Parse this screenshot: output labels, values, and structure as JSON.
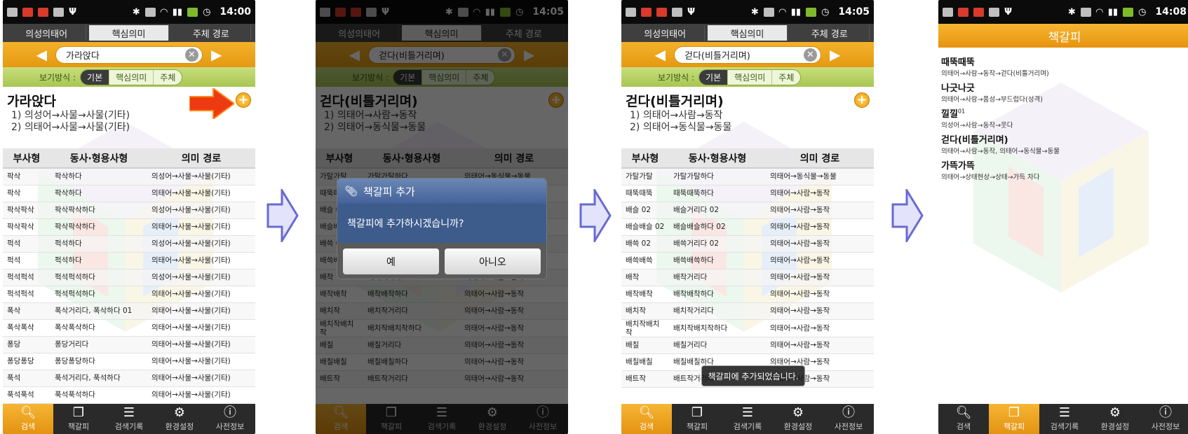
{
  "status": [
    {
      "time": "14:00"
    },
    {
      "time": "14:05"
    },
    {
      "time": "14:05"
    },
    {
      "time": "14:08"
    }
  ],
  "tabs": [
    "의성의태어",
    "핵심의미",
    "주체 경로"
  ],
  "search": [
    {
      "value": "가라앉다"
    },
    {
      "value": "걷다(비틀거리며)"
    },
    {
      "value": "걷다(비틀거리며)"
    }
  ],
  "view": {
    "label": "보기방식 :",
    "options": [
      "기본",
      "핵심의미",
      "주체"
    ]
  },
  "headers": [
    "부사형",
    "동사·형용사형",
    "의미 경로"
  ],
  "screen1": {
    "word": "가라앉다",
    "senses": [
      "1) 의성어→사물→사물(기타)",
      "2) 의태어→사물→사물(기타)"
    ],
    "rows": [
      [
        "팍삭",
        "팍삭하다",
        "의성어→사물→사물(기타)"
      ],
      [
        "팍삭",
        "팍삭하다",
        "의태어→사물→사물(기타)"
      ],
      [
        "팍삭팍삭",
        "팍삭팍삭하다",
        "의성어→사물→사물(기타)"
      ],
      [
        "팍삭팍삭",
        "팍삭팍삭하다",
        "의태어→사물→사물(기타)"
      ],
      [
        "퍽석",
        "퍽석하다",
        "의성어→사물→사물(기타)"
      ],
      [
        "퍽석",
        "퍽석하다",
        "의태어→사물→사물(기타)"
      ],
      [
        "퍽석퍽석",
        "퍽석퍽석하다",
        "의성어→사물→사물(기타)"
      ],
      [
        "퍽석퍽석",
        "퍽석퍽석하다",
        "의태어→사물→사물(기타)"
      ],
      [
        "폭삭",
        "폭삭거리다, 폭삭하다 01",
        "의태어→사물→사물(기타)"
      ],
      [
        "폭삭폭삭",
        "폭삭폭삭하다",
        "의태어→사물→사물(기타)"
      ],
      [
        "퐁당",
        "퐁당거리다",
        "의태어→사물→사물(기타)"
      ],
      [
        "퐁당퐁당",
        "퐁당퐁당하다",
        "의태어→사물→사물(기타)"
      ],
      [
        "푹석",
        "푹석거리다, 푹석하다",
        "의태어→사물→사물(기타)"
      ],
      [
        "푹석푹석",
        "푹석푹석하다",
        "의태어→사물→사물(기타)"
      ]
    ]
  },
  "screen2": {
    "word": "걷다(비틀거리며)",
    "senses": [
      "1) 의태어→사람→동작",
      "2) 의태어→동식물→동물"
    ],
    "rows": [
      [
        "가탈가탈",
        "가탈가탈하다",
        "의태어→동식물→동물"
      ],
      [
        "때뚝때뚝",
        "때뚝때뚝하다",
        "의태어→사람→동작"
      ],
      [
        "배슬 02",
        "배슬거리다 02",
        "의태어→사람→동작"
      ],
      [
        "배슬배슬 02",
        "배슬배슬하다 02",
        "의태어→사람→동작"
      ],
      [
        "배쓱 02",
        "배쓱거리다 02",
        "의태어→사람→동작"
      ],
      [
        "배쓱배쓱",
        "배쓱배쓱하다",
        "의태어→사람→동작"
      ],
      [
        "배착",
        "배착거리다",
        "의태어→사람→동작"
      ],
      [
        "배착배착",
        "배착배착하다",
        "의태어→사람→동작"
      ],
      [
        "배치작",
        "배치작거리다",
        "의태어→사람→동작"
      ],
      [
        "배치작배치작",
        "배치작배치작하다",
        "의태어→사람→동작"
      ],
      [
        "배칠",
        "배칠거리다",
        "의태어→사람→동작"
      ],
      [
        "배칠배칠",
        "배칠배칠하다",
        "의태어→사람→동작"
      ],
      [
        "배트작",
        "배트작거리다",
        "의태어→사람→동작"
      ]
    ]
  },
  "dialog": {
    "title": "책갈피 추가",
    "message": "책갈피에 추가하시겠습니까?",
    "yes": "예",
    "no": "아니오"
  },
  "toast": "책갈피에 추가되었습니다.",
  "bookmarks": {
    "title": "책갈피",
    "items": [
      {
        "word": "때뚝때뚝",
        "path": "의태어→사람→동작→걷다(비틀거리며)"
      },
      {
        "word": "나긋나긋",
        "path": "의태어→사람→품성→부드럽다(성격)"
      },
      {
        "word": "낄낄",
        "sup": "01",
        "path": "의성어→사람→동작→웃다"
      },
      {
        "word": "걷다(비틀거리며)",
        "path": "의태어→사람→동작, 의태어→동식물→동물"
      },
      {
        "word": "가뜩가뜩",
        "path": "의태어→상태현상→상태→가득 차다"
      }
    ]
  },
  "nav": [
    {
      "label": "검색",
      "icon": "search-icon"
    },
    {
      "label": "책갈피",
      "icon": "bookmark-icon"
    },
    {
      "label": "검색기록",
      "icon": "history-icon"
    },
    {
      "label": "환경설정",
      "icon": "gear-icon"
    },
    {
      "label": "사전정보",
      "icon": "info-icon"
    }
  ],
  "colors": {
    "accent": "#f0a21c",
    "view_bar": "#b8d165",
    "dialog_blue": "#3d5c8c",
    "step_arrow": "#6a6ad0"
  }
}
